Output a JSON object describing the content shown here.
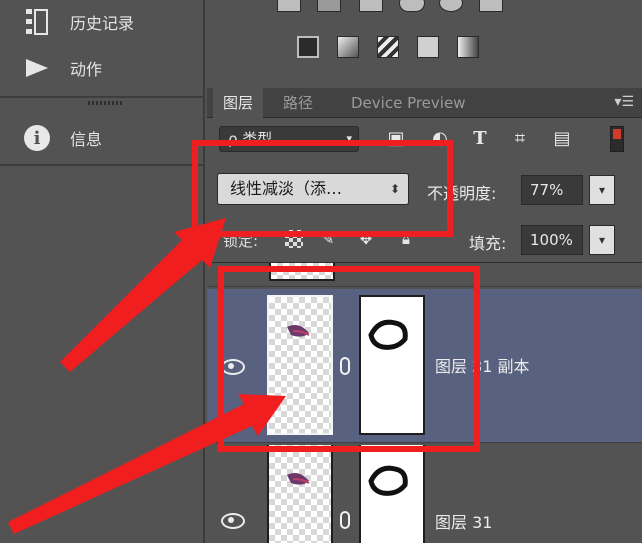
{
  "left_panel": {
    "items": [
      {
        "label": "历史记录",
        "icon": "history-icon"
      },
      {
        "label": "动作",
        "icon": "play-icon"
      },
      {
        "label": "信息",
        "icon": "info-icon"
      }
    ]
  },
  "layers_panel": {
    "tabs": [
      {
        "label": "图层",
        "active": true
      },
      {
        "label": "路径",
        "active": false
      },
      {
        "label": "Device Preview",
        "active": false
      }
    ],
    "filter_type": "ρ 类型",
    "blend_mode": "线性减淡（添…",
    "opacity_label": "不透明度:",
    "opacity_value": "77%",
    "lock_label": "锁定:",
    "fill_label": "填充:",
    "fill_value": "100%",
    "layers": [
      {
        "name": "图层 31 副本",
        "selected": true,
        "visible": true
      },
      {
        "name": "图层 31",
        "selected": false,
        "visible": true
      }
    ]
  },
  "colors": {
    "panel_bg": "#535353",
    "selected_row": "#586280",
    "annotation_red": "#f01e1e"
  }
}
